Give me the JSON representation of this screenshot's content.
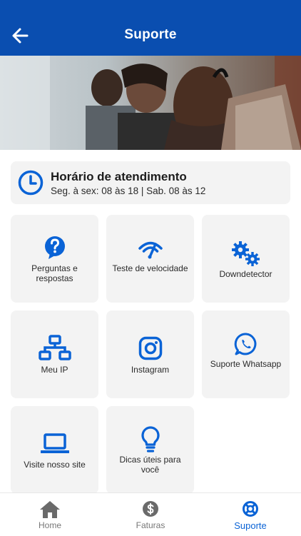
{
  "header": {
    "title": "Suporte"
  },
  "hours": {
    "title": "Horário de atendimento",
    "text": "Seg. à sex: 08 às 18 | Sab. 08 às 12"
  },
  "tiles": [
    {
      "label": "Perguntas e respostas",
      "icon": "question-icon"
    },
    {
      "label": "Teste de velocidade",
      "icon": "speedometer-icon"
    },
    {
      "label": "Downdetector",
      "icon": "gears-icon"
    },
    {
      "label": "Meu IP",
      "icon": "network-icon"
    },
    {
      "label": "Instagram",
      "icon": "instagram-icon"
    },
    {
      "label": "Suporte Whatsapp",
      "icon": "whatsapp-icon"
    },
    {
      "label": "Visite nosso  site",
      "icon": "laptop-icon"
    },
    {
      "label": "Dicas úteis para você",
      "icon": "lightbulb-icon"
    }
  ],
  "nav": [
    {
      "label": "Home",
      "icon": "home-icon",
      "active": false
    },
    {
      "label": "Faturas",
      "icon": "dollar-icon",
      "active": false
    },
    {
      "label": "Suporte",
      "icon": "lifebuoy-icon",
      "active": true
    }
  ],
  "colors": {
    "brand": "#0a4eb0",
    "icon": "#0a63d6",
    "tile_bg": "#f3f3f3"
  }
}
